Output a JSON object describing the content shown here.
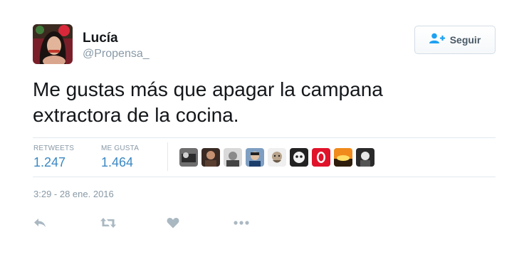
{
  "author": {
    "name": "Lucía",
    "handle": "@Propensa_",
    "avatar_icon": "profile-photo"
  },
  "follow_button": {
    "label": "Seguir",
    "icon": "add-user-icon",
    "color": "#1da1f2"
  },
  "tweet": {
    "text_line1": "Me gustas más que apagar la campana",
    "text_line2": "extractora de la cocina."
  },
  "stats": {
    "retweets_label": "RETWEETS",
    "retweets_value": "1.247",
    "likes_label": "ME GUSTA",
    "likes_value": "1.464"
  },
  "likers": [
    "liker-1",
    "liker-2",
    "liker-3",
    "liker-4",
    "liker-5",
    "liker-6",
    "liker-7",
    "liker-8",
    "liker-9"
  ],
  "timestamp": "3:29 - 28 ene. 2016",
  "actions": [
    "reply-icon",
    "retweet-icon",
    "like-icon",
    "more-icon"
  ],
  "colors": {
    "accent": "#3b88c3",
    "muted": "#8899a6",
    "action": "#aab8c2"
  }
}
